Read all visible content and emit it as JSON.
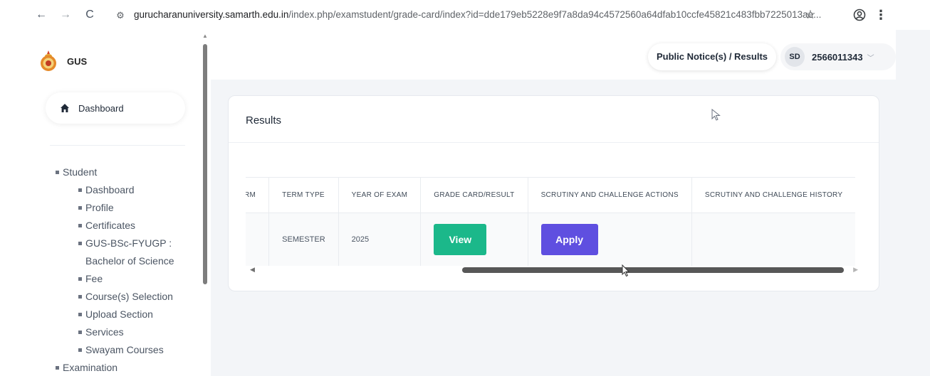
{
  "browser": {
    "url_domain": "gurucharanuniversity.samarth.edu.in",
    "url_path": "/index.php/examstudent/grade-card/index?id=dde179eb5228e9f7a8da94c4572560a64dfab10ccfe45821c483fbb7225013ae...",
    "back_icon": "arrow-left-icon",
    "forward_icon": "arrow-right-icon",
    "reload_icon": "reload-icon"
  },
  "sidebar": {
    "brand": "GUS",
    "dashboard_label": "Dashboard",
    "menu": [
      {
        "label": "Student",
        "level": 1
      },
      {
        "label": "Dashboard",
        "level": 2
      },
      {
        "label": "Profile",
        "level": 2
      },
      {
        "label": "Certificates",
        "level": 2
      },
      {
        "label": "GUS-BSc-FYUGP : Bachelor of Science",
        "level": 2
      },
      {
        "label": "Fee",
        "level": 2
      },
      {
        "label": "Course(s) Selection",
        "level": 2
      },
      {
        "label": "Upload Section",
        "level": 2
      },
      {
        "label": "Services",
        "level": 2
      },
      {
        "label": "Swayam Courses",
        "level": 2
      },
      {
        "label": "Examination",
        "level": 1
      }
    ]
  },
  "header": {
    "notice_button": "Public Notice(s) / Results",
    "avatar_initials": "SD",
    "user_id": "2566011343"
  },
  "results": {
    "title": "Results",
    "columns": [
      "RM",
      "TERM TYPE",
      "YEAR OF EXAM",
      "GRADE CARD/RESULT",
      "SCRUTINY AND CHALLENGE ACTIONS",
      "SCRUTINY AND CHALLENGE HISTORY"
    ],
    "row": {
      "term": "",
      "term_type": "SEMESTER",
      "year": "2025",
      "grade_action": "View",
      "scrutiny_action": "Apply",
      "history": ""
    }
  },
  "colors": {
    "view_button": "#1bb88a",
    "apply_button": "#5f4fe0",
    "main_bg": "#f3f5f8"
  }
}
